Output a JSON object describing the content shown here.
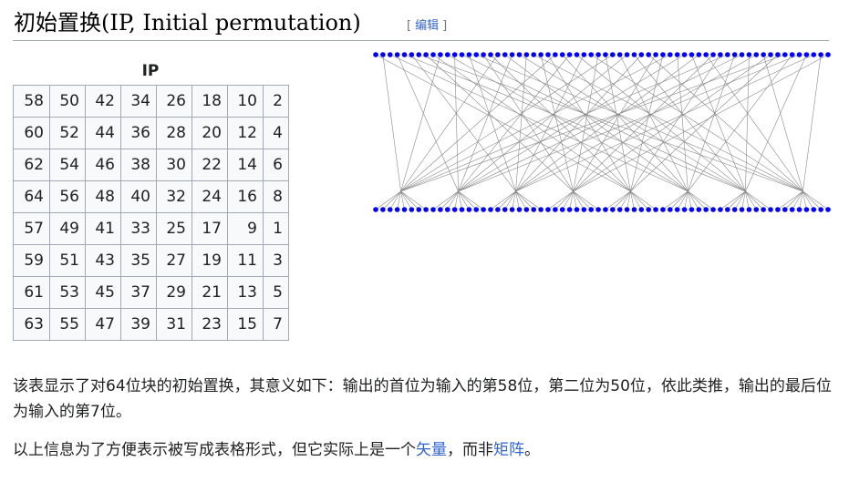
{
  "heading": {
    "title": "初始置换(IP, Initial permutation)",
    "edit_open": "[",
    "edit_label": "编辑",
    "edit_close": "]"
  },
  "table": {
    "caption": "IP",
    "rows": [
      [
        "58",
        "50",
        "42",
        "34",
        "26",
        "18",
        "10",
        "2"
      ],
      [
        "60",
        "52",
        "44",
        "36",
        "28",
        "20",
        "12",
        "4"
      ],
      [
        "62",
        "54",
        "46",
        "38",
        "30",
        "22",
        "14",
        "6"
      ],
      [
        "64",
        "56",
        "48",
        "40",
        "32",
        "24",
        "16",
        "8"
      ],
      [
        "57",
        "49",
        "41",
        "33",
        "25",
        "17",
        "9",
        "1"
      ],
      [
        "59",
        "51",
        "43",
        "35",
        "27",
        "19",
        "11",
        "3"
      ],
      [
        "61",
        "53",
        "45",
        "37",
        "29",
        "21",
        "13",
        "5"
      ],
      [
        "63",
        "55",
        "47",
        "39",
        "31",
        "23",
        "15",
        "7"
      ]
    ]
  },
  "diagram": {
    "dot_color": "#0000ff",
    "line_color": "#888888",
    "dot_count": 64
  },
  "paragraphs": {
    "p1": "该表显示了对64位块的初始置换，其意义如下：输出的首位为输入的第58位，第二位为50位，依此类推，输出的最后位为输入的第7位。",
    "p2_before": "以上信息为了方便表示被写成表格形式，但它实际上是一个",
    "p2_link1": "矢量",
    "p2_middle": "，而非",
    "p2_link2": "矩阵",
    "p2_after": "。"
  }
}
